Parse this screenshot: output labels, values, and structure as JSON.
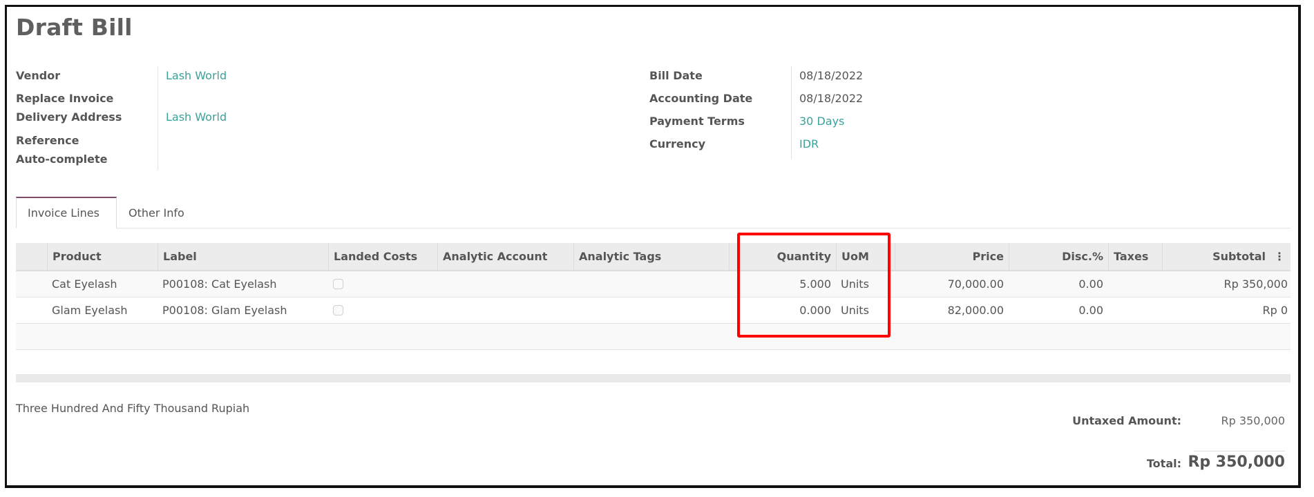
{
  "page": {
    "title": "Draft Bill"
  },
  "header_left": {
    "vendor_label": "Vendor",
    "vendor_value": "Lash World",
    "replace_invoice_label": "Replace Invoice",
    "delivery_address_label": "Delivery Address",
    "delivery_address_value": "Lash World",
    "reference_label": "Reference",
    "auto_complete_label": "Auto-complete"
  },
  "header_right": {
    "bill_date_label": "Bill Date",
    "bill_date_value": "08/18/2022",
    "accounting_date_label": "Accounting Date",
    "accounting_date_value": "08/18/2022",
    "payment_terms_label": "Payment Terms",
    "payment_terms_value": "30 Days",
    "currency_label": "Currency",
    "currency_value": "IDR"
  },
  "tabs": [
    {
      "label": "Invoice Lines",
      "active": true
    },
    {
      "label": "Other Info",
      "active": false
    }
  ],
  "table": {
    "columns": [
      "Product",
      "Label",
      "Landed Costs",
      "Analytic Account",
      "Analytic Tags",
      "Quantity",
      "UoM",
      "Price",
      "Disc.%",
      "Taxes",
      "Subtotal"
    ],
    "options_icon": "kebab-vertical-icon",
    "options_glyph": "⋮",
    "rows": [
      {
        "product": "Cat Eyelash",
        "label": "P00108: Cat Eyelash",
        "landed_costs": false,
        "analytic_account": "",
        "analytic_tags": "",
        "quantity": "5.000",
        "uom": "Units",
        "price": "70,000.00",
        "discount": "0.00",
        "taxes": "",
        "subtotal": "Rp 350,000"
      },
      {
        "product": "Glam Eyelash",
        "label": "P00108: Glam Eyelash",
        "landed_costs": false,
        "analytic_account": "",
        "analytic_tags": "",
        "quantity": "0.000",
        "uom": "Units",
        "price": "82,000.00",
        "discount": "0.00",
        "taxes": "",
        "subtotal": "Rp 0"
      }
    ]
  },
  "totals": {
    "amount_in_words": "Three Hundred And Fifty Thousand Rupiah",
    "untaxed_label": "Untaxed Amount:",
    "untaxed_value": "Rp 350,000",
    "total_label": "Total:",
    "total_value": "Rp 350,000"
  },
  "annotation": {
    "highlight_color": "#ff0000",
    "highlight_target": "Quantity and UoM columns"
  },
  "colors": {
    "link_teal": "#3aa29b",
    "tab_accent": "#7d4a6a",
    "header_bg": "#ececec"
  }
}
